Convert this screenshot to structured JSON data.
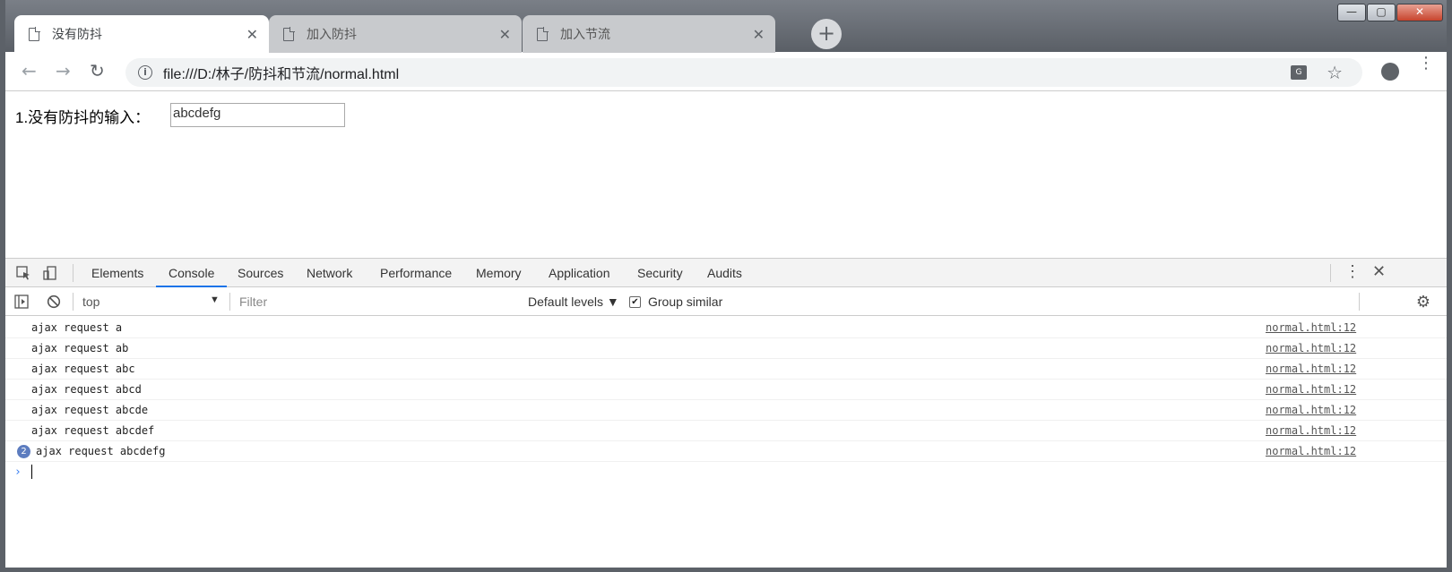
{
  "tabs": [
    {
      "title": "没有防抖",
      "close": "✕"
    },
    {
      "title": "加入防抖",
      "close": "✕"
    },
    {
      "title": "加入节流",
      "close": "✕"
    }
  ],
  "newtab": "+",
  "window_buttons": {
    "minimize": "—",
    "maximize": "▢",
    "close": "✕"
  },
  "toolbar": {
    "back": "←",
    "forward": "→",
    "reload": "↻",
    "url": "file:///D:/林子/防抖和节流/normal.html",
    "info": "i",
    "translate": "G",
    "star": "☆",
    "menu": "⋮"
  },
  "page": {
    "label": "1.没有防抖的输入：",
    "input_value": "abcdefg"
  },
  "devtools": {
    "tabs": [
      "Elements",
      "Console",
      "Sources",
      "Network",
      "Performance",
      "Memory",
      "Application",
      "Security",
      "Audits"
    ],
    "active_tab": "Console",
    "context": "top",
    "filter_placeholder": "Filter",
    "levels": "Default levels ▼",
    "group_similar": "Group similar",
    "menu": "⋮",
    "close": "✕",
    "gear": "⚙",
    "logs": [
      {
        "msg": "ajax request a",
        "src": "normal.html:12"
      },
      {
        "msg": "ajax request ab",
        "src": "normal.html:12"
      },
      {
        "msg": "ajax request abc",
        "src": "normal.html:12"
      },
      {
        "msg": "ajax request abcd",
        "src": "normal.html:12"
      },
      {
        "msg": "ajax request abcde",
        "src": "normal.html:12"
      },
      {
        "msg": "ajax request abcdef",
        "src": "normal.html:12"
      },
      {
        "msg": "ajax request abcdefg",
        "src": "normal.html:12",
        "count": "2"
      }
    ],
    "prompt": "›"
  },
  "colors": {
    "accent": "#1a73e8",
    "badge": "#5c7cbf"
  }
}
